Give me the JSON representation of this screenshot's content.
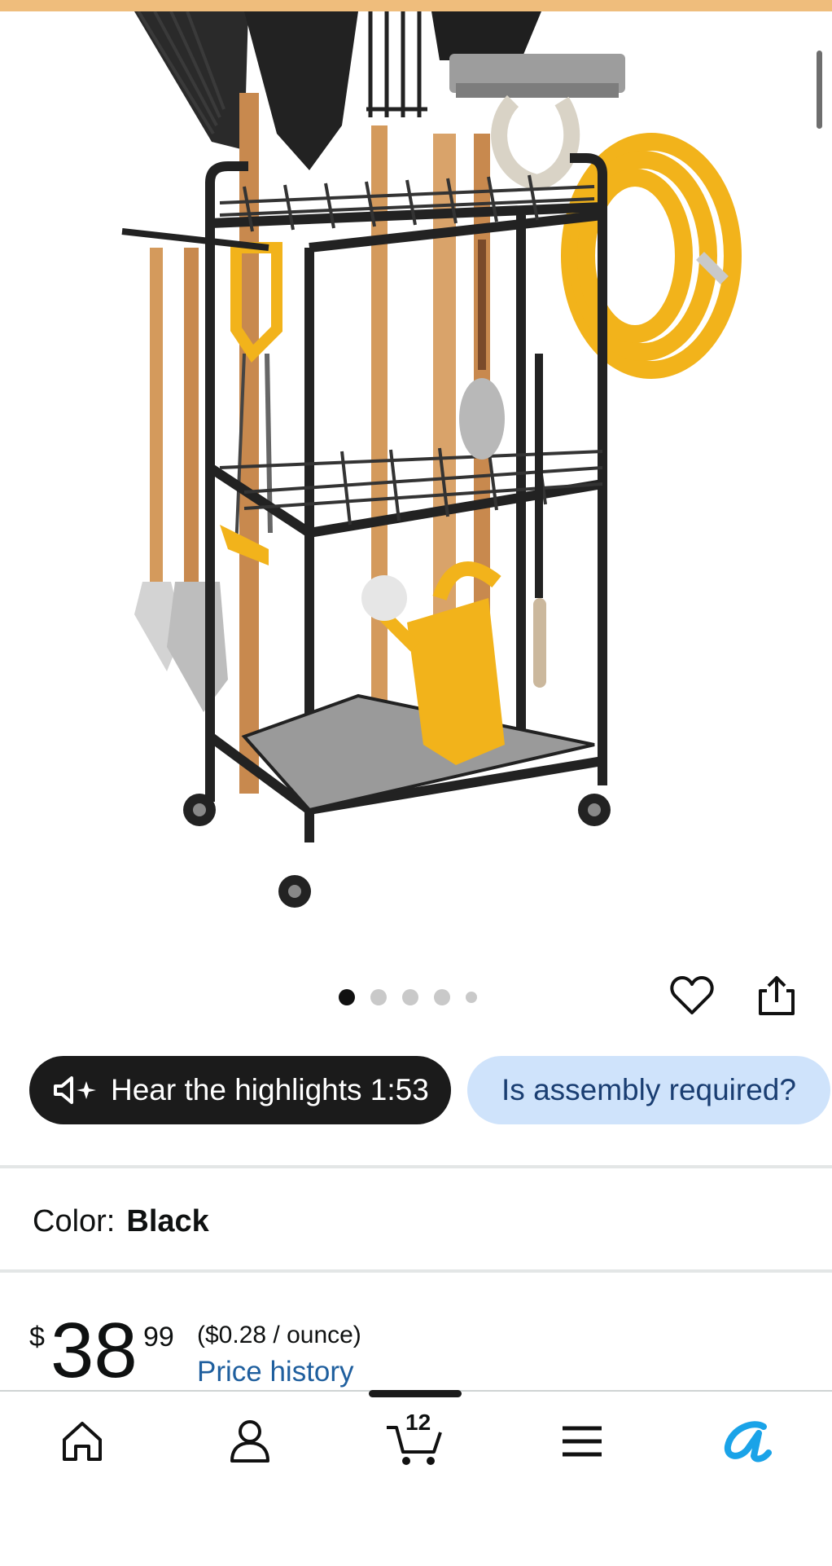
{
  "image_carousel": {
    "alt": "garden tool storage cart",
    "dots": [
      true,
      false,
      false,
      false,
      false
    ],
    "current_index": 1,
    "total": 5
  },
  "icons": {
    "wishlist": "heart-icon",
    "share": "share-icon",
    "speaker": "speaker-sparkle-icon",
    "home": "home-icon",
    "account": "account-icon",
    "cart": "cart-icon",
    "menu": "menu-icon",
    "rufus": "rufus-icon"
  },
  "actions": {
    "hear_highlights": "Hear the highlights 1:53",
    "assembly_question": "Is assembly required?"
  },
  "color": {
    "label": "Color:",
    "value": "Black"
  },
  "price": {
    "currency": "$",
    "whole": "38",
    "fraction": "99",
    "unit_price": "($0.28 / ounce)",
    "history_link": "Price history"
  },
  "bottom_nav": {
    "cart_count": "12"
  },
  "colors": {
    "top_strip": "#efbd7c",
    "dark_pill": "#1b1b1b",
    "light_pill": "#cfe3fb",
    "link": "#1f5f9e",
    "rufus_accent": "#1aa3e8",
    "hose_yellow": "#f2b31b"
  }
}
